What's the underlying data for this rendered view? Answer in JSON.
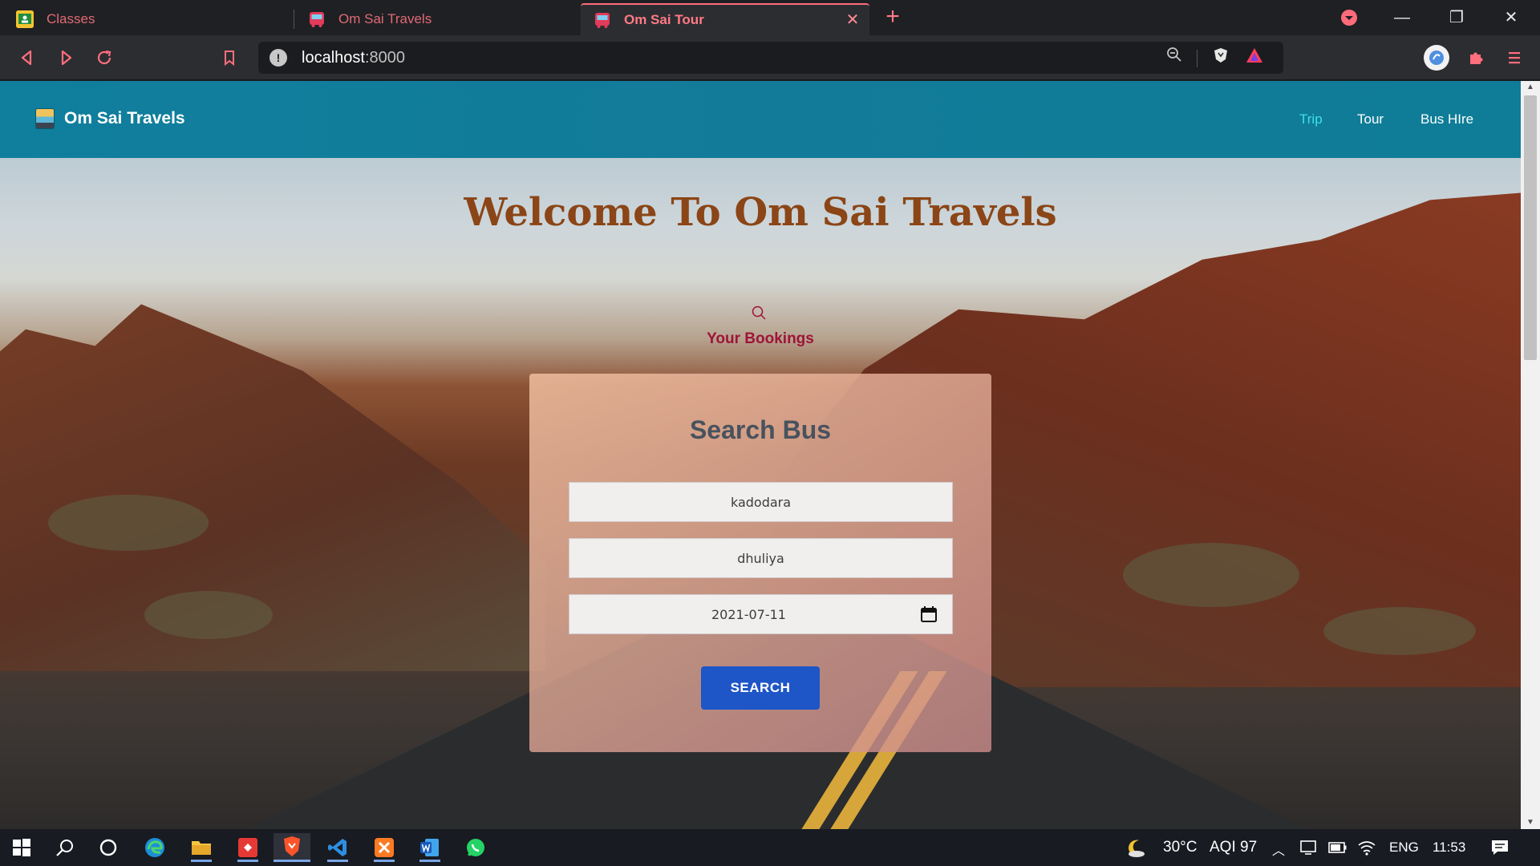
{
  "browser": {
    "tabs": [
      {
        "label": "Classes",
        "active": false
      },
      {
        "label": "Om Sai Travels",
        "active": false
      },
      {
        "label": "Om Sai Tour",
        "active": true
      }
    ],
    "url_host": "localhost",
    "url_port": ":8000"
  },
  "navbar": {
    "brand": "Om Sai Travels",
    "links": [
      "Trip",
      "Tour",
      "Bus HIre"
    ],
    "active_link": "Trip"
  },
  "hero": {
    "title": "Welcome To Om Sai Travels",
    "bookings_link": "Your Bookings"
  },
  "search_card": {
    "title": "Search Bus",
    "from_value": "kadodara",
    "to_value": "dhuliya",
    "date_value": "2021-07-11",
    "button_label": "SEARCH"
  },
  "taskbar": {
    "weather": "30°C",
    "aqi": "AQI 97",
    "language": "ENG",
    "time": "11:53"
  },
  "colors": {
    "navbar": "#127b99",
    "title": "#8b4516",
    "bookings": "#9e1438",
    "button": "#1e55c7",
    "browser_accent": "#ff6b7a"
  }
}
